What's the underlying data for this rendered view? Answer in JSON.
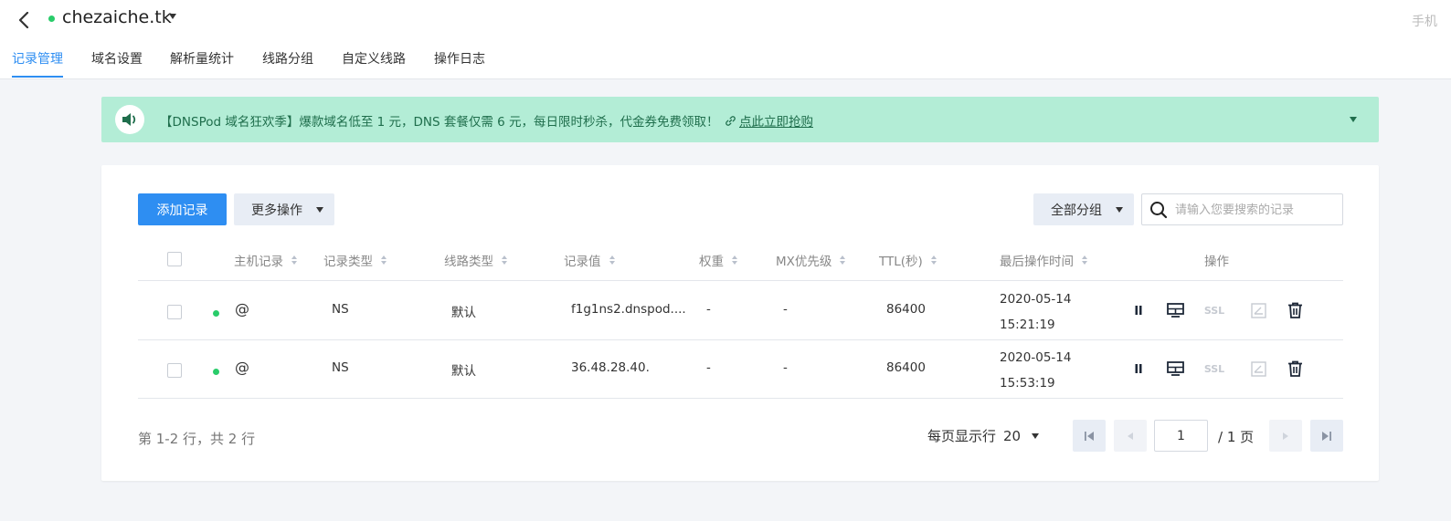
{
  "header": {
    "domain": "chezaiche.tk",
    "right_text": "手机"
  },
  "tabs": [
    {
      "label": "记录管理",
      "active": true
    },
    {
      "label": "域名设置"
    },
    {
      "label": "解析量统计"
    },
    {
      "label": "线路分组"
    },
    {
      "label": "自定义线路"
    },
    {
      "label": "操作日志"
    }
  ],
  "banner": {
    "text": "【DNSPod 域名狂欢季】爆款域名低至 1 元，DNS 套餐仅需 6 元，每日限时秒杀，代金券免费领取！",
    "link": "点此立即抢购"
  },
  "toolbar": {
    "add_label": "添加记录",
    "more_label": "更多操作",
    "group_label": "全部分组",
    "search_placeholder": "请输入您要搜索的记录"
  },
  "table": {
    "columns": [
      "主机记录",
      "记录类型",
      "线路类型",
      "记录值",
      "权重",
      "MX优先级",
      "TTL(秒)",
      "最后操作时间",
      "操作"
    ],
    "rows": [
      {
        "host": "@",
        "type": "NS",
        "line": "默认",
        "value": "f1g1ns2.dnspod....",
        "weight": "-",
        "mx": "-",
        "ttl": "86400",
        "date": "2020-05-14",
        "time": "15:21:19",
        "status": "enabled"
      },
      {
        "host": "@",
        "type": "NS",
        "line": "默认",
        "value": "36.48.28.40.",
        "weight": "-",
        "mx": "-",
        "ttl": "86400",
        "date": "2020-05-14",
        "time": "15:53:19",
        "status": "enabled"
      }
    ],
    "ssl_label": "SSL"
  },
  "footer": {
    "count": "第 1-2 行，共 2 行",
    "per_page_label": "每页显示行",
    "per_page_value": "20",
    "page": "1",
    "total_pages": "/ 1 页"
  },
  "colors": {
    "accent": "#2e8ef2",
    "status_green": "#29cc6a",
    "banner_bg": "#b3edd6"
  }
}
